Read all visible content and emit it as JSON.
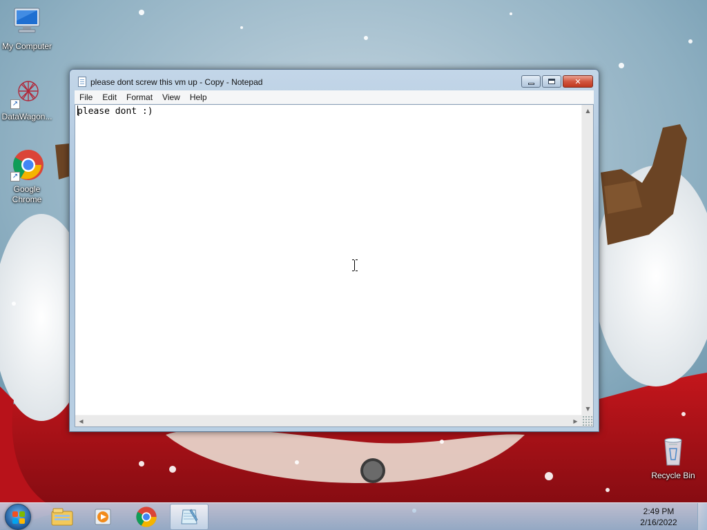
{
  "desktop": {
    "icons": [
      {
        "label": "My Computer",
        "icon": "computer-icon"
      },
      {
        "label": "DataWagon...",
        "icon": "datawagon-icon"
      },
      {
        "label": "Google Chrome",
        "icon": "chrome-icon"
      },
      {
        "label": "Recycle Bin",
        "icon": "recycle-bin-icon"
      }
    ]
  },
  "notepad": {
    "title": "please dont screw this vm up - Copy - Notepad",
    "menu": [
      "File",
      "Edit",
      "Format",
      "View",
      "Help"
    ],
    "content": "please dont :)",
    "controls": {
      "minimize_icon": "minimize-icon",
      "maximize_icon": "maximize-icon",
      "close_icon": "close-icon"
    }
  },
  "taskbar": {
    "start_icon": "windows-start-orb",
    "pinned": [
      {
        "icon": "windows-explorer-icon"
      },
      {
        "icon": "media-player-icon"
      },
      {
        "icon": "chrome-icon"
      },
      {
        "icon": "notepad-icon",
        "active": true
      }
    ],
    "clock": {
      "time": "2:49 PM",
      "date": "2/16/2022"
    }
  },
  "colors": {
    "window_frame": "#b9cfe3",
    "close_button": "#c9452c",
    "taskbar": "#a9c6e0"
  }
}
